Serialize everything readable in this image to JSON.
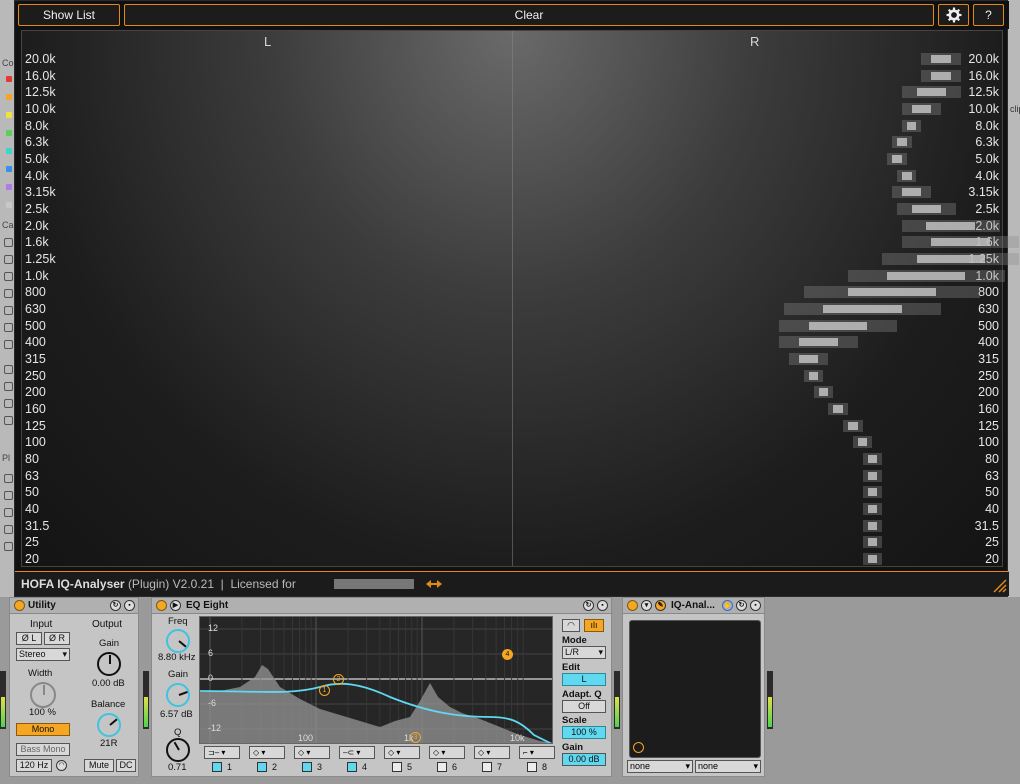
{
  "host": {
    "left_labels": [
      "Co",
      "Ca",
      "Pl"
    ],
    "right_label": "clip",
    "color_dots": [
      "#e53935",
      "#f5a623",
      "#f0e040",
      "#5ad05a",
      "#3ad6c8",
      "#3a8fe8",
      "#b07ae8",
      "#c8c8c8"
    ]
  },
  "analyser": {
    "show_list_label": "Show List",
    "clear_label": "Clear",
    "help_label": "?",
    "settings_icon": "gear-icon",
    "left_channel": "L",
    "right_channel": "R",
    "freq_labels": [
      "20.0k",
      "16.0k",
      "12.5k",
      "10.0k",
      "8.0k",
      "6.3k",
      "5.0k",
      "4.0k",
      "3.15k",
      "2.5k",
      "2.0k",
      "1.6k",
      "1.25k",
      "1.0k",
      "800",
      "630",
      "500",
      "400",
      "315",
      "250",
      "200",
      "160",
      "125",
      "100",
      "80",
      "63",
      "50",
      "40",
      "31.5",
      "25",
      "20"
    ],
    "right_bars": [
      {
        "level": 0.1,
        "spread": 0.02
      },
      {
        "level": 0.1,
        "spread": 0.02
      },
      {
        "level": 0.12,
        "spread": 0.03
      },
      {
        "level": 0.14,
        "spread": 0.02
      },
      {
        "level": 0.16,
        "spread": 0.01
      },
      {
        "level": 0.18,
        "spread": 0.01
      },
      {
        "level": 0.19,
        "spread": 0.01
      },
      {
        "level": 0.17,
        "spread": 0.01
      },
      {
        "level": 0.16,
        "spread": 0.02
      },
      {
        "level": 0.13,
        "spread": 0.03
      },
      {
        "level": 0.08,
        "spread": 0.05
      },
      {
        "level": 0.06,
        "spread": 0.06
      },
      {
        "level": 0.08,
        "spread": 0.07
      },
      {
        "level": 0.13,
        "spread": 0.08
      },
      {
        "level": 0.2,
        "spread": 0.09
      },
      {
        "level": 0.26,
        "spread": 0.08
      },
      {
        "level": 0.31,
        "spread": 0.06
      },
      {
        "level": 0.35,
        "spread": 0.04
      },
      {
        "level": 0.37,
        "spread": 0.02
      },
      {
        "level": 0.36,
        "spread": 0.01
      },
      {
        "level": 0.34,
        "spread": 0.01
      },
      {
        "level": 0.31,
        "spread": 0.01
      },
      {
        "level": 0.28,
        "spread": 0.01
      },
      {
        "level": 0.26,
        "spread": 0.01
      },
      {
        "level": 0.24,
        "spread": 0.01
      },
      {
        "level": 0.24,
        "spread": 0.01
      },
      {
        "level": 0.24,
        "spread": 0.01
      },
      {
        "level": 0.24,
        "spread": 0.01
      },
      {
        "level": 0.24,
        "spread": 0.01
      },
      {
        "level": 0.24,
        "spread": 0.01
      },
      {
        "level": 0.24,
        "spread": 0.01
      }
    ],
    "footer_brand": "HOFA IQ-Analyser",
    "footer_type": "(Plugin)",
    "footer_version": "V2.0.21",
    "footer_license": "Licensed for",
    "footer_arrow_icon": "double-arrow-icon"
  },
  "utility": {
    "title": "Utility",
    "input_label": "Input",
    "output_label": "Output",
    "phase_l": "Ø L",
    "phase_r": "Ø R",
    "channel_mode": "Stereo",
    "gain_label": "Gain",
    "gain_value": "0.00 dB",
    "width_label": "Width",
    "width_value": "100 %",
    "mono_label": "Mono",
    "balance_label": "Balance",
    "balance_value": "21R",
    "bass_mono_label": "Bass Mono",
    "bass_freq": "120 Hz",
    "mute_label": "Mute",
    "dc_label": "DC"
  },
  "eq": {
    "title": "EQ Eight",
    "freq_label": "Freq",
    "freq_value": "8.80 kHz",
    "gain_label": "Gain",
    "gain_value": "6.57 dB",
    "q_label": "Q",
    "q_value": "0.71",
    "db_ticks": [
      "12",
      "6",
      "0",
      "-6",
      "-12"
    ],
    "freq_ticks": [
      "100",
      "1k",
      "10k"
    ],
    "mode_label": "Mode",
    "mode_value": "L/R",
    "edit_label": "Edit",
    "edit_value": "L",
    "adapt_label": "Adapt. Q",
    "adapt_value": "Off",
    "scale_label": "Scale",
    "scale_value": "100 %",
    "out_gain_label": "Gain",
    "out_gain_value": "0.00 dB",
    "bands": [
      {
        "num": "1",
        "on": true
      },
      {
        "num": "2",
        "on": true
      },
      {
        "num": "3",
        "on": true
      },
      {
        "num": "4",
        "on": true
      },
      {
        "num": "5",
        "on": false
      },
      {
        "num": "6",
        "on": false
      },
      {
        "num": "7",
        "on": false
      },
      {
        "num": "8",
        "on": false
      }
    ],
    "nodes": [
      "1",
      "2",
      "3",
      "4"
    ]
  },
  "iq": {
    "title": "IQ-Anal...",
    "sidechain_1": "none",
    "sidechain_2": "none"
  }
}
